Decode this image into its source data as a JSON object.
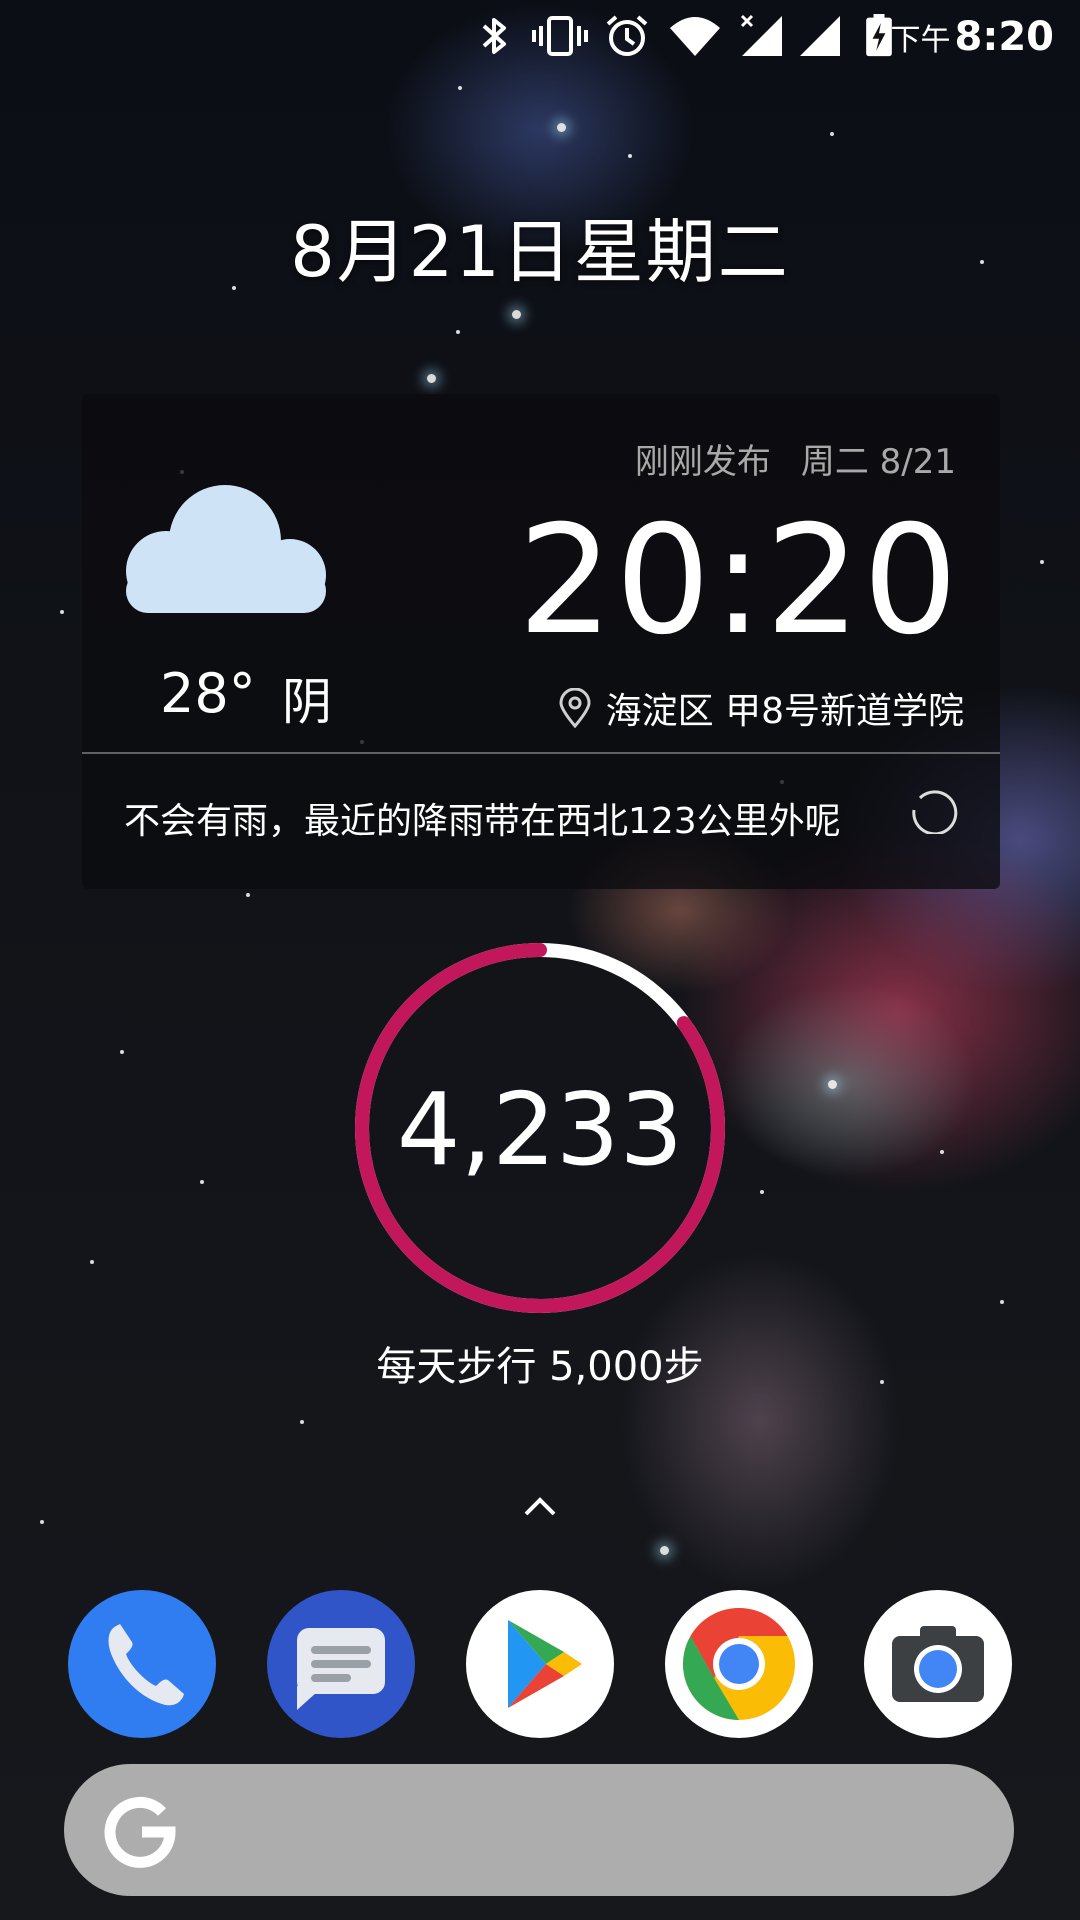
{
  "status_bar": {
    "period": "下午",
    "time": "8:20",
    "icons": [
      "bluetooth-icon",
      "vibrate-icon",
      "alarm-icon",
      "wifi-icon",
      "signal-x-icon",
      "signal-icon",
      "battery-charging-icon"
    ]
  },
  "date_label": "8月21日星期二",
  "weather": {
    "temperature": "28°",
    "condition": "阴",
    "published": "刚刚发布",
    "day_date": "周二 8/21",
    "clock": "20:20",
    "location": "海淀区 甲8号新道学院",
    "rain_message": "不会有雨，最近的降雨带在西北123公里外呢",
    "icon": "cloud-icon"
  },
  "fitness": {
    "steps": "4,233",
    "goal_label": "每天步行 5,000步",
    "progress": 0.85,
    "ring_color": "#c2185b",
    "track_color": "#ffffff"
  },
  "dock": [
    {
      "name": "phone",
      "icon": "phone-icon"
    },
    {
      "name": "messages",
      "icon": "messages-icon"
    },
    {
      "name": "play-store",
      "icon": "play-store-icon"
    },
    {
      "name": "chrome",
      "icon": "chrome-icon"
    },
    {
      "name": "camera",
      "icon": "camera-icon"
    }
  ],
  "search": {
    "icon": "google-g-icon"
  }
}
